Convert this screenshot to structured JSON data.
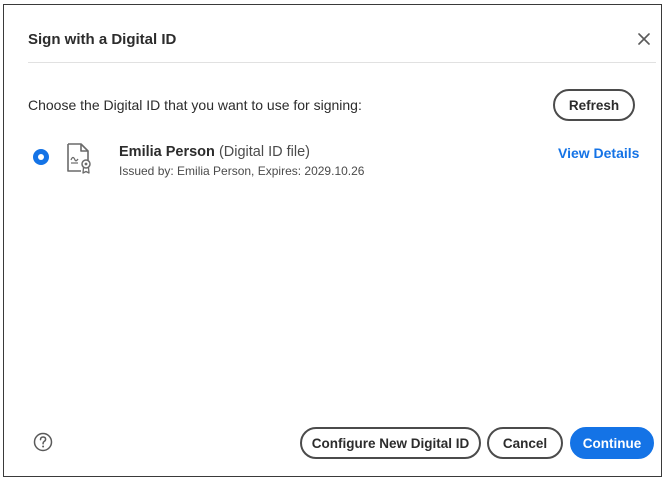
{
  "dialog": {
    "title": "Sign with a Digital ID",
    "close_icon": "close-icon",
    "prompt": "Choose the Digital ID that you want to use for signing:",
    "refresh_label": "Refresh"
  },
  "digital_ids": [
    {
      "name": "Emilia Person",
      "type": "(Digital ID file)",
      "meta": "Issued by: Emilia Person, Expires: 2029.10.26",
      "selected": true,
      "icon": "certificate-icon",
      "view_details_label": "View Details"
    }
  ],
  "footer": {
    "help_icon": "help-icon",
    "configure_label": "Configure New Digital ID",
    "cancel_label": "Cancel",
    "continue_label": "Continue"
  },
  "colors": {
    "accent": "#1473e6",
    "text": "#2c2c2c",
    "border": "#4b4b4b"
  }
}
